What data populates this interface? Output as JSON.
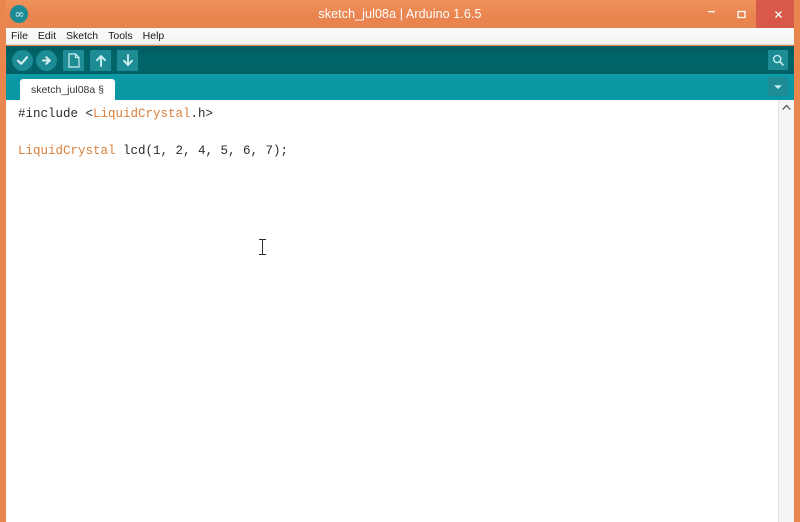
{
  "window": {
    "title": "sketch_jul08a | Arduino 1.6.5",
    "logo_icon": "arduino-infinity-icon",
    "logo_glyph": "∞",
    "controls": {
      "minimize_label": "–",
      "maximize_label": "□",
      "close_label": "×"
    },
    "colors": {
      "frame": "#e8864e",
      "titlebar": "#ea8550",
      "close_button": "#d8594a",
      "toolbar": "#00666b",
      "tabstrip": "#0b9aa6",
      "icon_tile": "#1d8c94",
      "editor_background": "#ffffff",
      "code_text": "#2b2b2b",
      "code_library": "#d9803c"
    }
  },
  "menu": {
    "items": [
      {
        "label": "File"
      },
      {
        "label": "Edit"
      },
      {
        "label": "Sketch"
      },
      {
        "label": "Tools"
      },
      {
        "label": "Help"
      }
    ]
  },
  "toolbar": {
    "buttons": [
      {
        "name": "verify-button",
        "icon": "check-circle-icon",
        "tooltip": "Verify"
      },
      {
        "name": "upload-button",
        "icon": "arrow-right-circle-icon",
        "tooltip": "Upload"
      },
      {
        "name": "new-button",
        "icon": "new-document-icon",
        "tooltip": "New"
      },
      {
        "name": "open-button",
        "icon": "arrow-up-icon",
        "tooltip": "Open"
      },
      {
        "name": "save-button",
        "icon": "arrow-down-icon",
        "tooltip": "Save"
      }
    ],
    "serial_monitor": {
      "icon": "magnifier-icon",
      "tooltip": "Serial Monitor"
    }
  },
  "tabs": {
    "active_tab_label": "sketch_jul08a §",
    "menu_button_icon": "chevron-down-icon"
  },
  "editor": {
    "lines": [
      {
        "tokens": [
          {
            "text": "#include <",
            "type": "plain"
          },
          {
            "text": "LiquidCrystal",
            "type": "lib"
          },
          {
            "text": ".h>",
            "type": "plain"
          }
        ]
      },
      {
        "tokens": []
      },
      {
        "tokens": [
          {
            "text": "LiquidCrystal",
            "type": "lib"
          },
          {
            "text": " lcd(1, 2, 4, 5, 6, 7);",
            "type": "plain"
          }
        ]
      }
    ],
    "cursor_icon": "text-ibeam-cursor"
  },
  "scrollbar": {
    "up_arrow_icon": "chevron-up-icon"
  }
}
